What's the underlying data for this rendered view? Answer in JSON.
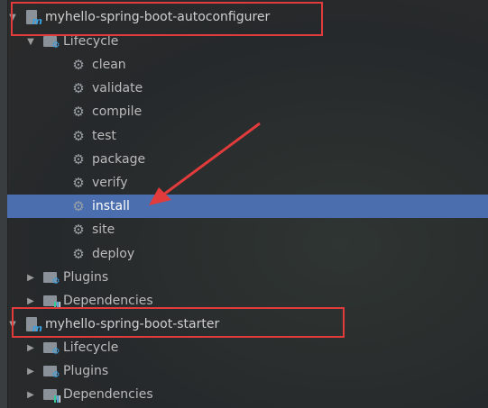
{
  "modules": [
    {
      "name": "myhello-spring-boot-autoconfigurer",
      "lifecycle_label": "Lifecycle",
      "phases": [
        "clean",
        "validate",
        "compile",
        "test",
        "package",
        "verify",
        "install",
        "site",
        "deploy"
      ],
      "plugins_label": "Plugins",
      "dependencies_label": "Dependencies"
    },
    {
      "name": "myhello-spring-boot-starter",
      "lifecycle_label": "Lifecycle",
      "plugins_label": "Plugins",
      "dependencies_label": "Dependencies"
    }
  ],
  "selected": "install",
  "colors": {
    "selection": "#4b6eaf",
    "highlight_box": "#e23b3b",
    "arrow": "#e23b3b"
  }
}
